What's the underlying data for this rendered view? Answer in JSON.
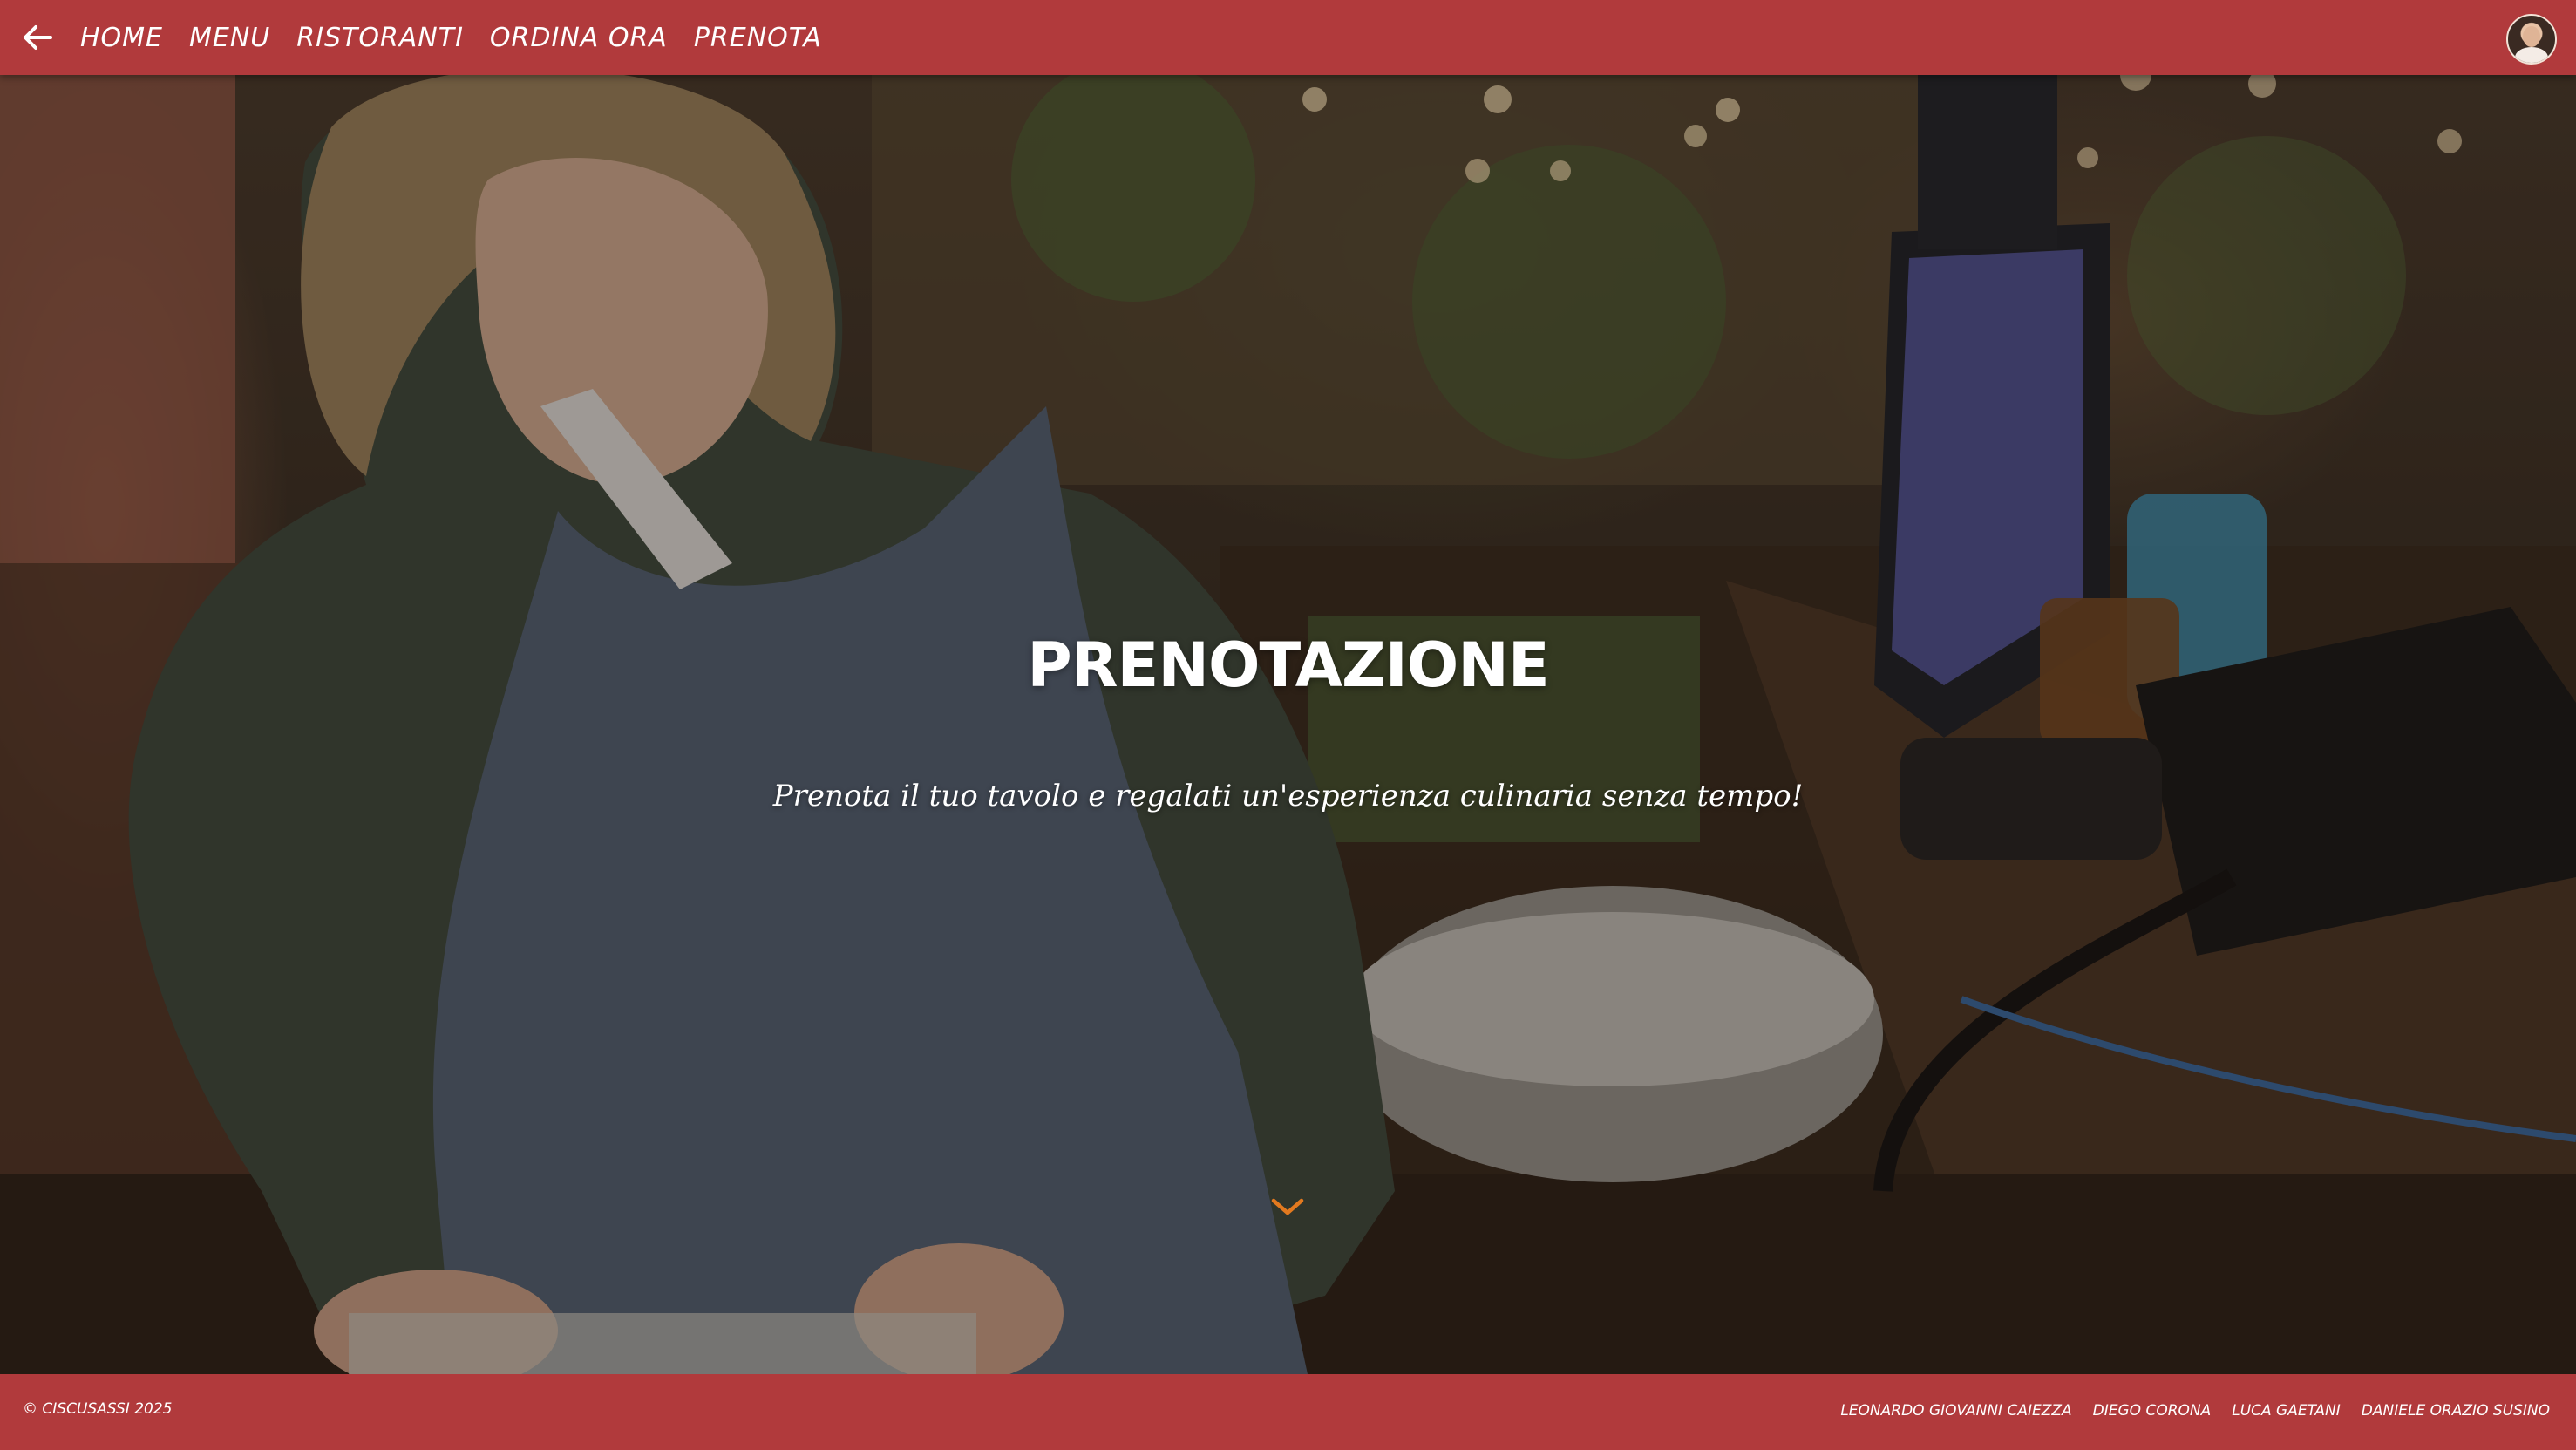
{
  "nav": {
    "items": [
      {
        "label": "HOME"
      },
      {
        "label": "MENU"
      },
      {
        "label": "RISTORANTI"
      },
      {
        "label": "ORDINA ORA"
      },
      {
        "label": "PRENOTA"
      }
    ],
    "back_icon": "arrow-left-icon",
    "avatar_icon": "user-avatar"
  },
  "hero": {
    "title": "PRENOTAZIONE",
    "subtitle": "Prenota il tuo tavolo e regalati un'esperienza culinaria senza tempo!",
    "scroll_icon": "chevron-down-icon"
  },
  "footer": {
    "copyright": "© CISCUSASSI 2025",
    "authors": [
      "LEONARDO GIOVANNI CAIEZZA",
      "DIEGO CORONA",
      "LUCA GAETANI",
      "DANIELE ORAZIO SUSINO"
    ]
  },
  "colors": {
    "brand_red": "#b13a3c",
    "text": "#ffffff",
    "accent_chevron": "#e2791f"
  }
}
